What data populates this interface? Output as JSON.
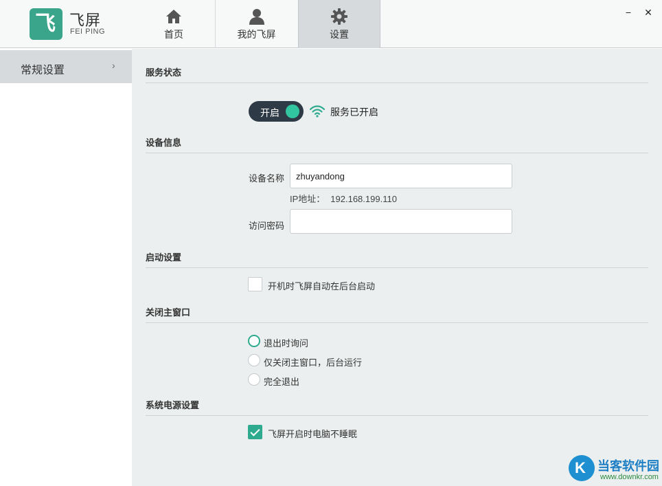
{
  "app": {
    "name": "飞屏",
    "subtitle": "FEI PING",
    "logo_glyph": "飞",
    "accent_color": "#2eab8f"
  },
  "tabs": [
    {
      "label": "首页",
      "icon": "home-icon"
    },
    {
      "label": "我的飞屏",
      "icon": "user-icon"
    },
    {
      "label": "设置",
      "icon": "gear-icon",
      "active": true
    }
  ],
  "window_controls": {
    "minimize": "−",
    "close": "✕"
  },
  "sidebar": {
    "items": [
      {
        "label": "常规设置",
        "chevron": "›",
        "active": true
      }
    ]
  },
  "service": {
    "title": "服务状态",
    "toggle_label": "开启",
    "toggle_on": true,
    "status_text": "服务已开启"
  },
  "device": {
    "title": "设备信息",
    "name_label": "设备名称",
    "name_value": "zhuyandong",
    "ip_label": "IP地址：",
    "ip_value": "192.168.199.110",
    "password_label": "访问密码",
    "password_value": ""
  },
  "startup": {
    "title": "启动设置",
    "option_label": "开机时飞屏自动在后台启动",
    "checked": false
  },
  "close_window": {
    "title": "关闭主窗口",
    "options": [
      {
        "label": "退出时询问",
        "selected": true
      },
      {
        "label": "仅关闭主窗口，后台运行",
        "selected": false
      },
      {
        "label": "完全退出",
        "selected": false
      }
    ]
  },
  "power": {
    "title": "系统电源设置",
    "option_label": "飞屏开启时电脑不睡眠",
    "checked": true
  },
  "watermark": {
    "text": "当客软件园",
    "url": "www.downkr.com",
    "glyph": "K"
  }
}
